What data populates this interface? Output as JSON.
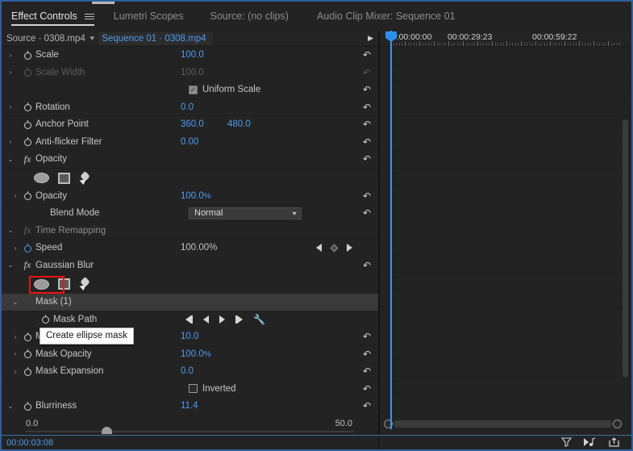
{
  "window": {
    "title": "Effect Controls"
  },
  "tabs": [
    {
      "label": "Effect Controls",
      "active": true
    },
    {
      "label": "Lumetri Scopes",
      "active": false
    },
    {
      "label": "Source: (no clips)",
      "active": false
    },
    {
      "label": "Audio Clip Mixer: Sequence 01",
      "active": false
    }
  ],
  "source_row": {
    "source_label": "Source · 0308.mp4",
    "sequence_label": "Sequence 01 · 0308.mp4"
  },
  "parameters": [
    {
      "name": "Scale",
      "value": "100.0",
      "twirl": "›",
      "stopwatch": true,
      "indent": 1,
      "dim": false
    },
    {
      "name": "Scale Width",
      "value": "100.0",
      "twirl": "›",
      "stopwatch": true,
      "indent": 1,
      "dim": true
    },
    {
      "name": "Uniform Scale",
      "checkbox": true,
      "checked": true,
      "indent": 2,
      "dim": false
    },
    {
      "name": "Rotation",
      "value": "0.0",
      "twirl": "›",
      "stopwatch": true,
      "indent": 1,
      "dim": false
    },
    {
      "name": "Anchor Point",
      "value": "360.0",
      "value2": "480.0",
      "stopwatch": true,
      "indent": 1,
      "dim": false
    },
    {
      "name": "Anti-flicker Filter",
      "value": "0.00",
      "twirl": "›",
      "stopwatch": true,
      "indent": 1,
      "dim": false
    }
  ],
  "opacity_group": {
    "title": "Opacity",
    "fx": "fx",
    "twirl": "⌄",
    "mask_tools": [
      {
        "name": "create-ellipse-mask",
        "tooltip": "Create ellipse mask"
      },
      {
        "name": "create-4-point-polygon-mask",
        "tooltip": "Create 4-point polygon mask"
      },
      {
        "name": "free-draw-bezier",
        "tooltip": "Free draw bezier"
      }
    ],
    "rows": [
      {
        "name": "Opacity",
        "value": "100.0",
        "unit": "%",
        "twirl": "›",
        "stopwatch": true
      },
      {
        "name": "Blend Mode",
        "select_value": "Normal"
      }
    ]
  },
  "time_remapping": {
    "title": "Time Remapping",
    "fx": "fx",
    "twirl": "⌄",
    "rows": [
      {
        "name": "Speed",
        "value": "100.00%",
        "twirl": "›",
        "stopwatch_on": true
      }
    ]
  },
  "gaussian_blur": {
    "title": "Gaussian Blur",
    "fx": "fx",
    "twirl": "⌄",
    "mask_group": {
      "label": "Mask (1)",
      "twirl": "⌄",
      "highlighted": true
    },
    "rows": [
      {
        "name": "Mask Path",
        "track_controls": true,
        "stopwatch": true
      },
      {
        "name": "Mask Feather",
        "value": "10.0",
        "twirl": "›",
        "stopwatch": true
      },
      {
        "name": "Mask Opacity",
        "value": "100.0",
        "unit": "%",
        "twirl": "›",
        "stopwatch": true
      },
      {
        "name": "Mask Expansion",
        "value": "0.0",
        "twirl": "›",
        "stopwatch": true
      },
      {
        "name": "Inverted",
        "checkbox": true,
        "checked": false
      },
      {
        "name": "Blurriness",
        "value": "11.4",
        "twirl": "⌄",
        "stopwatch": true
      }
    ],
    "slider": {
      "min": "0.0",
      "max": "50.0",
      "value": 11.4,
      "range_max": 50
    }
  },
  "tooltip": {
    "text": "Create ellipse mask",
    "visible": true
  },
  "timeline": {
    "ruler_labels": [
      "00:00:00:00",
      "00:00:29:23",
      "00:00:59:22"
    ],
    "playhead_time": "00:00:00:00"
  },
  "status_bar": {
    "timecode": "00:00:03:08",
    "icons": [
      {
        "name": "filter-icon",
        "glyph": "▼"
      },
      {
        "name": "audio-play-icon",
        "glyph": "♪"
      },
      {
        "name": "export-icon",
        "glyph": "↱"
      }
    ]
  },
  "colors": {
    "accent_blue": "#4f9bf0",
    "panel_bg": "#232323",
    "highlight_red": "#ee1111",
    "border_blue": "#2f5f9e"
  }
}
